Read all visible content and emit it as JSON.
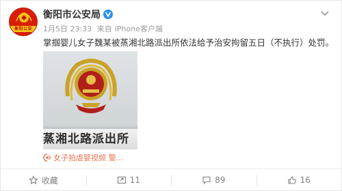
{
  "post": {
    "username": "衡阳市公安局",
    "verified_icon": "verified-v-icon",
    "date": "1月5日 23:33",
    "source_prefix": "来自",
    "source": "iPhone客户端",
    "text": "掌掴婴儿女子魏某被蒸湘北路派出所依法给予治安拘留五日（不执行）处罚。",
    "avatar_band_text": "衡阳公安",
    "image_sign_text": "蒸湘北路派出所",
    "video_link": "女子拍虐婴视频 警...",
    "video_link_icon": "video-link-icon"
  },
  "actions": {
    "favorite_label": "收藏",
    "repost_count": "11",
    "comment_count": "89",
    "like_count": "16"
  },
  "colors": {
    "link": "#eb7350",
    "verified": "#2c8ff0",
    "avatar": "#d81e06"
  }
}
